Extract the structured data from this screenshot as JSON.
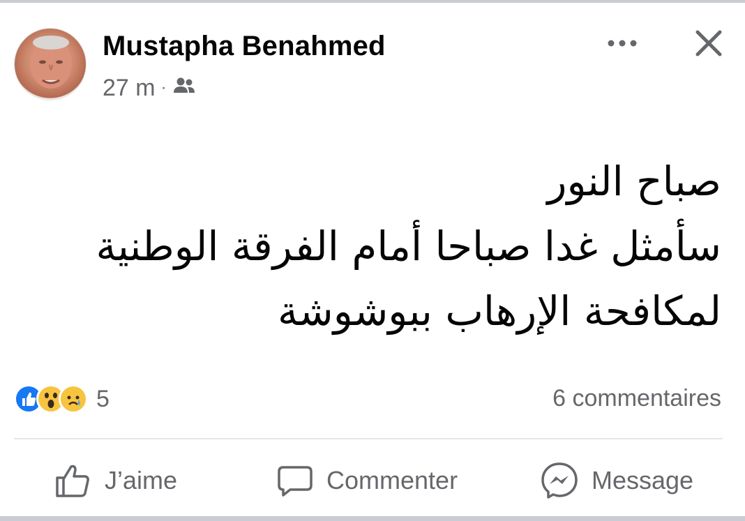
{
  "post": {
    "author": "Mustapha Benahmed",
    "time": "27 m",
    "separator": "·",
    "audience_icon": "friends-icon",
    "lines": [
      "صباح  النور",
      "سأمثل غدا صباحا أمام الفرقة الوطنية",
      "لمكافحة الإرهاب ببوشوشة"
    ]
  },
  "reactions": {
    "icons": [
      "like-icon",
      "wow-icon",
      "sad-icon"
    ],
    "count": "5"
  },
  "comments_label": "6 commentaires",
  "actions": {
    "like": "J’aime",
    "comment": "Commenter",
    "message": "Message"
  },
  "colors": {
    "text": "#050505",
    "secondary": "#65676b",
    "like_blue": "#1877f2",
    "emoji_yellow": "#f7c440",
    "divider": "#e4e6eb"
  }
}
